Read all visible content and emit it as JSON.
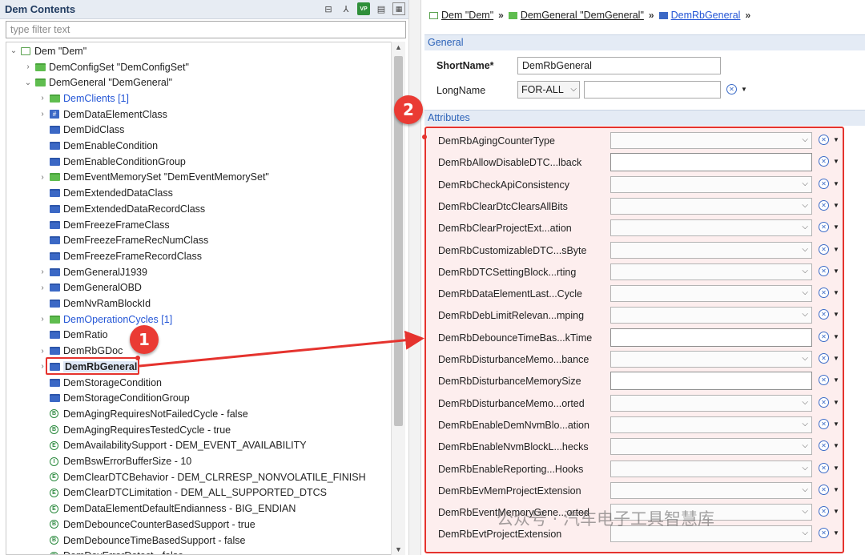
{
  "left_panel": {
    "title": "Dem Contents",
    "filter_placeholder": "type filter text",
    "tree": [
      {
        "label": "Dem \"Dem\"",
        "icon": "root-module-icon",
        "twisty": "expanded",
        "level": 0
      },
      {
        "label": "DemConfigSet \"DemConfigSet\"",
        "icon": "folder-green-icon",
        "twisty": "collapsed",
        "level": 1
      },
      {
        "label": "DemGeneral \"DemGeneral\"",
        "icon": "folder-green-icon",
        "twisty": "expanded",
        "level": 1
      },
      {
        "label": "DemClients [1]",
        "icon": "folder-green-icon",
        "twisty": "collapsed",
        "level": 2,
        "style": "link"
      },
      {
        "label": "DemDataElementClass",
        "icon": "data-element-class-icon",
        "twisty": "collapsed",
        "level": 2
      },
      {
        "label": "DemDidClass",
        "icon": "folder-blue-icon",
        "twisty": "none",
        "level": 2
      },
      {
        "label": "DemEnableCondition",
        "icon": "folder-blue-icon",
        "twisty": "none",
        "level": 2
      },
      {
        "label": "DemEnableConditionGroup",
        "icon": "folder-blue-icon",
        "twisty": "none",
        "level": 2
      },
      {
        "label": "DemEventMemorySet \"DemEventMemorySet\"",
        "icon": "folder-green-icon",
        "twisty": "collapsed",
        "level": 2
      },
      {
        "label": "DemExtendedDataClass",
        "icon": "folder-blue-icon",
        "twisty": "none",
        "level": 2
      },
      {
        "label": "DemExtendedDataRecordClass",
        "icon": "folder-blue-icon",
        "twisty": "none",
        "level": 2
      },
      {
        "label": "DemFreezeFrameClass",
        "icon": "folder-blue-icon",
        "twisty": "none",
        "level": 2
      },
      {
        "label": "DemFreezeFrameRecNumClass",
        "icon": "folder-blue-icon",
        "twisty": "none",
        "level": 2
      },
      {
        "label": "DemFreezeFrameRecordClass",
        "icon": "folder-blue-icon",
        "twisty": "none",
        "level": 2
      },
      {
        "label": "DemGeneralJ1939",
        "icon": "folder-blue-icon",
        "twisty": "collapsed",
        "level": 2
      },
      {
        "label": "DemGeneralOBD",
        "icon": "folder-blue-icon",
        "twisty": "collapsed",
        "level": 2
      },
      {
        "label": "DemNvRamBlockId",
        "icon": "folder-blue-icon",
        "twisty": "none",
        "level": 2
      },
      {
        "label": "DemOperationCycles [1]",
        "icon": "folder-green-icon",
        "twisty": "collapsed",
        "level": 2,
        "style": "link"
      },
      {
        "label": "DemRatio",
        "icon": "folder-blue-icon",
        "twisty": "none",
        "level": 2
      },
      {
        "label": "DemRbGDoc",
        "icon": "folder-blue-icon",
        "twisty": "collapsed",
        "level": 2
      },
      {
        "label": "DemRbGeneral",
        "icon": "folder-blue-icon",
        "twisty": "collapsed",
        "level": 2,
        "style": "selected"
      },
      {
        "label": "DemStorageCondition",
        "icon": "folder-blue-icon",
        "twisty": "none",
        "level": 2
      },
      {
        "label": "DemStorageConditionGroup",
        "icon": "folder-blue-icon",
        "twisty": "none",
        "level": 2
      },
      {
        "label": "DemAgingRequiresNotFailedCycle - false",
        "icon": "boolean-param-icon",
        "twisty": "none",
        "level": 2
      },
      {
        "label": "DemAgingRequiresTestedCycle - true",
        "icon": "boolean-param-icon",
        "twisty": "none",
        "level": 2
      },
      {
        "label": "DemAvailabilitySupport - DEM_EVENT_AVAILABILITY",
        "icon": "enum-param-icon",
        "twisty": "none",
        "level": 2
      },
      {
        "label": "DemBswErrorBufferSize - 10",
        "icon": "integer-param-icon",
        "twisty": "none",
        "level": 2
      },
      {
        "label": "DemClearDTCBehavior - DEM_CLRRESP_NONVOLATILE_FINISH",
        "icon": "enum-param-icon",
        "twisty": "none",
        "level": 2
      },
      {
        "label": "DemClearDTCLimitation - DEM_ALL_SUPPORTED_DTCS",
        "icon": "enum-param-icon",
        "twisty": "none",
        "level": 2
      },
      {
        "label": "DemDataElementDefaultEndianness - BIG_ENDIAN",
        "icon": "enum-param-icon",
        "twisty": "none",
        "level": 2
      },
      {
        "label": "DemDebounceCounterBasedSupport - true",
        "icon": "boolean-param-icon",
        "twisty": "none",
        "level": 2
      },
      {
        "label": "DemDebounceTimeBasedSupport - false",
        "icon": "boolean-param-icon",
        "twisty": "none",
        "level": 2
      },
      {
        "label": "DemDevErrorDetect - false",
        "icon": "boolean-param-icon",
        "twisty": "none",
        "level": 2
      }
    ]
  },
  "breadcrumb": [
    {
      "label": "Dem \"Dem\"",
      "icon": "root-module-icon"
    },
    {
      "label": "DemGeneral \"DemGeneral\"",
      "icon": "folder-green-icon"
    },
    {
      "label": "DemRbGeneral",
      "icon": "folder-blue-icon",
      "active": true
    }
  ],
  "general_section": {
    "title": "General",
    "shortname_label": "ShortName*",
    "shortname_value": "DemRbGeneral",
    "longname_label": "LongName",
    "language_value": "FOR-ALL",
    "longname_value": ""
  },
  "attributes_section": {
    "title": "Attributes",
    "rows": [
      {
        "name": "DemRbAgingCounterType",
        "kind": "combo"
      },
      {
        "name": "DemRbAllowDisableDTC...lback",
        "kind": "text"
      },
      {
        "name": "DemRbCheckApiConsistency",
        "kind": "combo"
      },
      {
        "name": "DemRbClearDtcClearsAllBits",
        "kind": "combo"
      },
      {
        "name": "DemRbClearProjectExt...ation",
        "kind": "combo"
      },
      {
        "name": "DemRbCustomizableDTC...sByte",
        "kind": "combo"
      },
      {
        "name": "DemRbDTCSettingBlock...rting",
        "kind": "combo"
      },
      {
        "name": "DemRbDataElementLast...Cycle",
        "kind": "combo"
      },
      {
        "name": "DemRbDebLimitRelevan...mping",
        "kind": "combo"
      },
      {
        "name": "DemRbDebounceTimeBas...kTime",
        "kind": "text"
      },
      {
        "name": "DemRbDisturbanceMemo...bance",
        "kind": "combo"
      },
      {
        "name": "DemRbDisturbanceMemorySize",
        "kind": "text"
      },
      {
        "name": "DemRbDisturbanceMemo...orted",
        "kind": "combo"
      },
      {
        "name": "DemRbEnableDemNvmBlo...ation",
        "kind": "combo"
      },
      {
        "name": "DemRbEnableNvmBlockL...hecks",
        "kind": "combo"
      },
      {
        "name": "DemRbEnableReporting...Hooks",
        "kind": "combo"
      },
      {
        "name": "DemRbEvMemProjectExtension",
        "kind": "combo"
      },
      {
        "name": "DemRbEventMemoryGene...orted",
        "kind": "combo"
      },
      {
        "name": "DemRbEvtProjectExtension",
        "kind": "combo"
      }
    ]
  },
  "annotations": {
    "badge_1": "1",
    "badge_2": "2",
    "accent_color": "#e5332e"
  },
  "watermark": "公众号 · 汽车电子工具智慧库"
}
